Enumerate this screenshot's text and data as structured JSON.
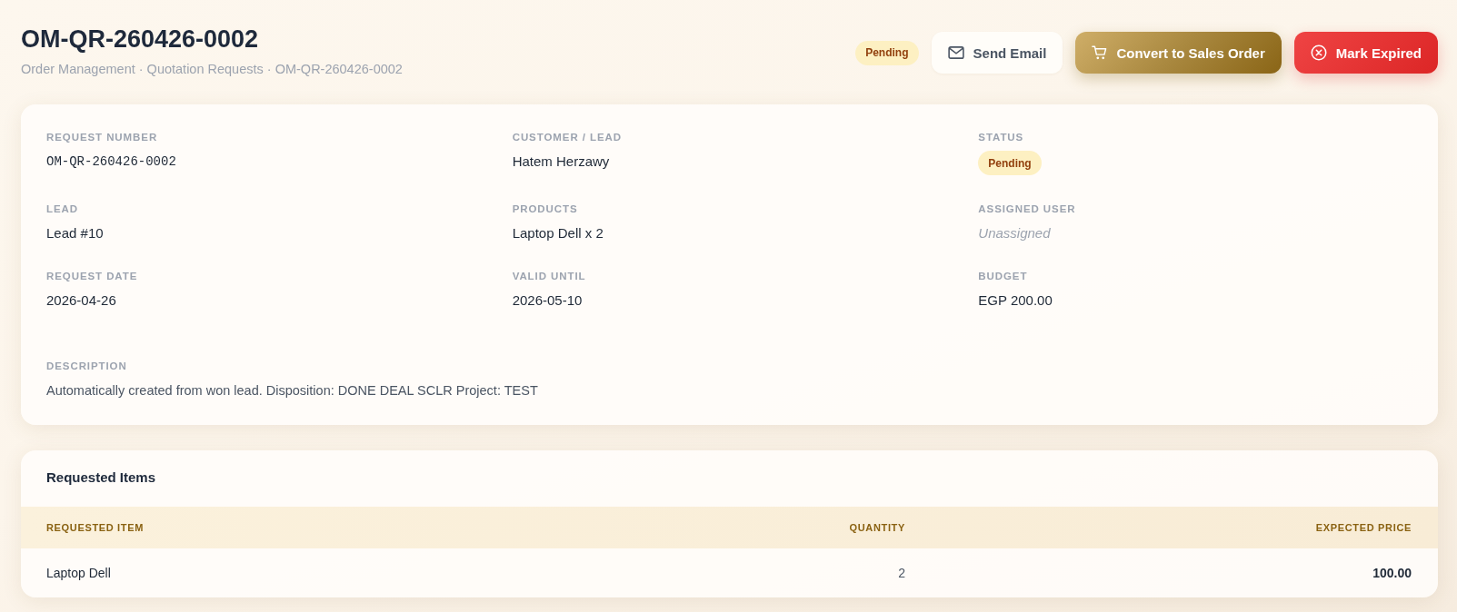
{
  "header": {
    "title": "OM-QR-260426-0002",
    "breadcrumb": "Order Management · Quotation Requests · OM-QR-260426-0002",
    "status": {
      "label": "Pending"
    },
    "actions": [
      {
        "label": "Send Email",
        "kind": "outline"
      },
      {
        "label": "Convert to Sales Order",
        "kind": "gold"
      },
      {
        "label": "Mark Expired",
        "kind": "danger"
      }
    ]
  },
  "details": {
    "fields": [
      {
        "label": "REQUEST NUMBER",
        "value": "OM-QR-260426-0002",
        "kind": "mono"
      },
      {
        "label": "CUSTOMER / LEAD",
        "value": "Hatem Herzawy",
        "kind": "text"
      },
      {
        "label": "STATUS",
        "value": "Pending",
        "kind": "badge"
      },
      {
        "label": "LEAD",
        "value": "Lead #10",
        "kind": "text"
      },
      {
        "label": "PRODUCTS",
        "value": "Laptop Dell x 2",
        "kind": "text"
      },
      {
        "label": "ASSIGNED USER",
        "value": "Unassigned",
        "kind": "empty"
      },
      {
        "label": "REQUEST DATE",
        "value": "2026-04-26",
        "kind": "text"
      },
      {
        "label": "VALID UNTIL",
        "value": "2026-05-10",
        "kind": "text"
      },
      {
        "label": "BUDGET",
        "value": "EGP 200.00",
        "kind": "text"
      }
    ],
    "description": {
      "label": "DESCRIPTION",
      "text": "Automatically created from won lead. Disposition: DONE DEAL SCLR Project: TEST"
    }
  },
  "requested_items": {
    "title": "Requested Items",
    "columns": [
      "REQUESTED ITEM",
      "QUANTITY",
      "EXPECTED PRICE"
    ],
    "rows": [
      [
        "Laptop Dell",
        "2",
        "100.00"
      ]
    ]
  }
}
